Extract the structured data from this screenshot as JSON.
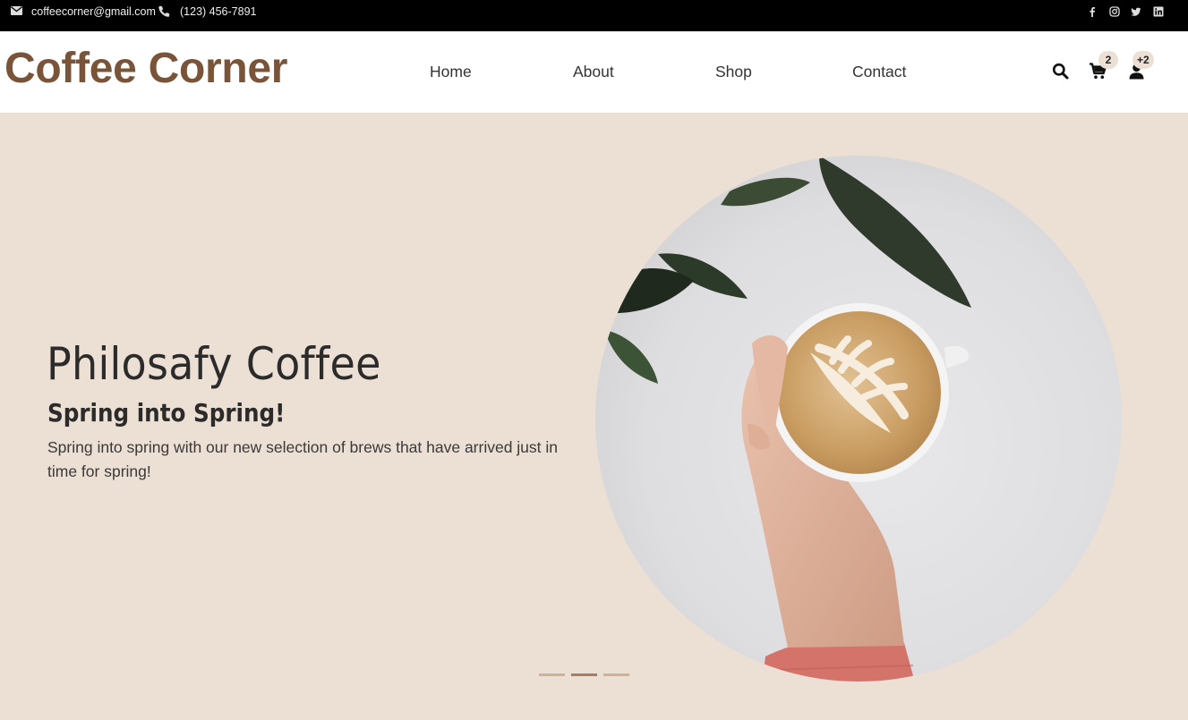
{
  "topbar": {
    "email": "coffeecorner@gmail.com",
    "phone": "(123) 456-7891",
    "icons": [
      "envelope-icon",
      "phone-icon",
      "facebook-icon",
      "instagram-icon",
      "twitter-icon",
      "linkedin-icon"
    ]
  },
  "header": {
    "logo": "Coffee Corner",
    "nav": [
      {
        "label": "Home"
      },
      {
        "label": "About"
      },
      {
        "label": "Shop"
      },
      {
        "label": "Contact"
      }
    ],
    "cart_count": "2",
    "account_badge": "+2"
  },
  "hero": {
    "title": "Philosafy Coffee",
    "subtitle": "Spring into Spring!",
    "body": "Spring into spring with our new selection of brews that have arrived just in time for spring!",
    "image_alt": "Hand holding a latte cup with leaf latte art next to a plant",
    "slides_total": 3,
    "active_slide": 2
  },
  "colors": {
    "brand": "#7a5439",
    "hero_background": "#ecdfd4",
    "topbar_background": "#000000",
    "slider_dot": "#cfb197",
    "slider_dot_active": "#a87c5f",
    "sleeve": "#d3736a"
  }
}
